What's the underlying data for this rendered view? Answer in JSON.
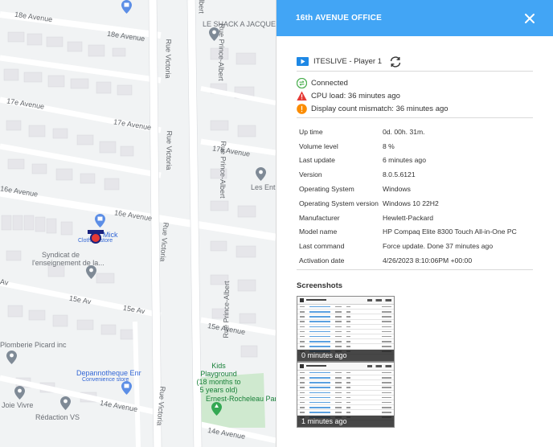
{
  "map": {
    "streets": {
      "ave_18_top": "18e Avenue",
      "ave_18_mid": "18e Avenue",
      "ave_17_a": "17e Avenue",
      "ave_17_b": "17e Avenue",
      "ave_17_c": "17e Avenue",
      "ave_16_a": "16e Avenue",
      "ave_16_b": "16e Avenue",
      "ave_15_a": "15e Av",
      "ave_15_b": "15e Av",
      "ave_15_c": "15e Avenue",
      "ave_14_a": "14e Avenue",
      "ave_14_b": "14e Avenue",
      "ave_partial": "Av",
      "victoria_1": "Rue Victoria",
      "victoria_2": "Rue Victoria",
      "victoria_3": "Rue Victoria",
      "victoria_4": "Rue Victoria",
      "prince_1": "Rue Prince-Albert",
      "prince_2": "Rue Prince-Albert",
      "prince_3": "Rue Prince-Albert",
      "prince_top": "Albert"
    },
    "places": {
      "le_shack": "LE SHACK A JACQUES",
      "les_entr": "Les Entr",
      "clothing_name": "Mick",
      "clothing_sub": "Clothing store",
      "syndicat_1": "Syndicat de",
      "syndicat_2": "l'enseignement de la...",
      "plomberie": "Plomberie Picard inc",
      "depanno": "Depannotheque Enr",
      "depanno_sub": "Convenience store",
      "kids_1": "Kids",
      "kids_2": "Playground",
      "kids_3": "(18 months to",
      "kids_4": "5 years old)",
      "ernest": "Ernest-Rocheleau Park",
      "joie": "Joie Vivre",
      "redaction": "Rédaction VS"
    }
  },
  "panel": {
    "title": "16th AVENUE OFFICE",
    "player_name": "ITESLIVE - Player 1",
    "statuses": [
      {
        "text": "Connected",
        "icon": "connected-icon",
        "color": "#4caf50"
      },
      {
        "text": "CPU load: 36 minutes ago",
        "icon": "warning-icon",
        "color": "#e53935"
      },
      {
        "text": "Display count mismatch: 36 minutes ago",
        "icon": "alert-icon",
        "color": "#fb8c00"
      }
    ],
    "info": [
      {
        "key": "Up time",
        "value": "0d. 00h. 31m."
      },
      {
        "key": "Volume level",
        "value": "8 %"
      },
      {
        "key": "Last update",
        "value": "6 minutes ago"
      },
      {
        "key": "Version",
        "value": "8.0.5.6121"
      },
      {
        "key": "Operating System",
        "value": "Windows"
      },
      {
        "key": "Operating System version",
        "value": "Windows 10 22H2"
      },
      {
        "key": "Manufacturer",
        "value": "Hewlett-Packard"
      },
      {
        "key": "Model name",
        "value": "HP Compaq Elite 8300 Touch All-in-One PC"
      },
      {
        "key": "Last command",
        "value": "Force update. Done 37 minutes ago"
      },
      {
        "key": "Activation date",
        "value": "4/26/2023 8:10:06PM +00:00"
      }
    ],
    "screenshots_title": "Screenshots",
    "screenshots": [
      {
        "caption": "0 minutes ago"
      },
      {
        "caption": "1 minutes ago"
      }
    ]
  }
}
